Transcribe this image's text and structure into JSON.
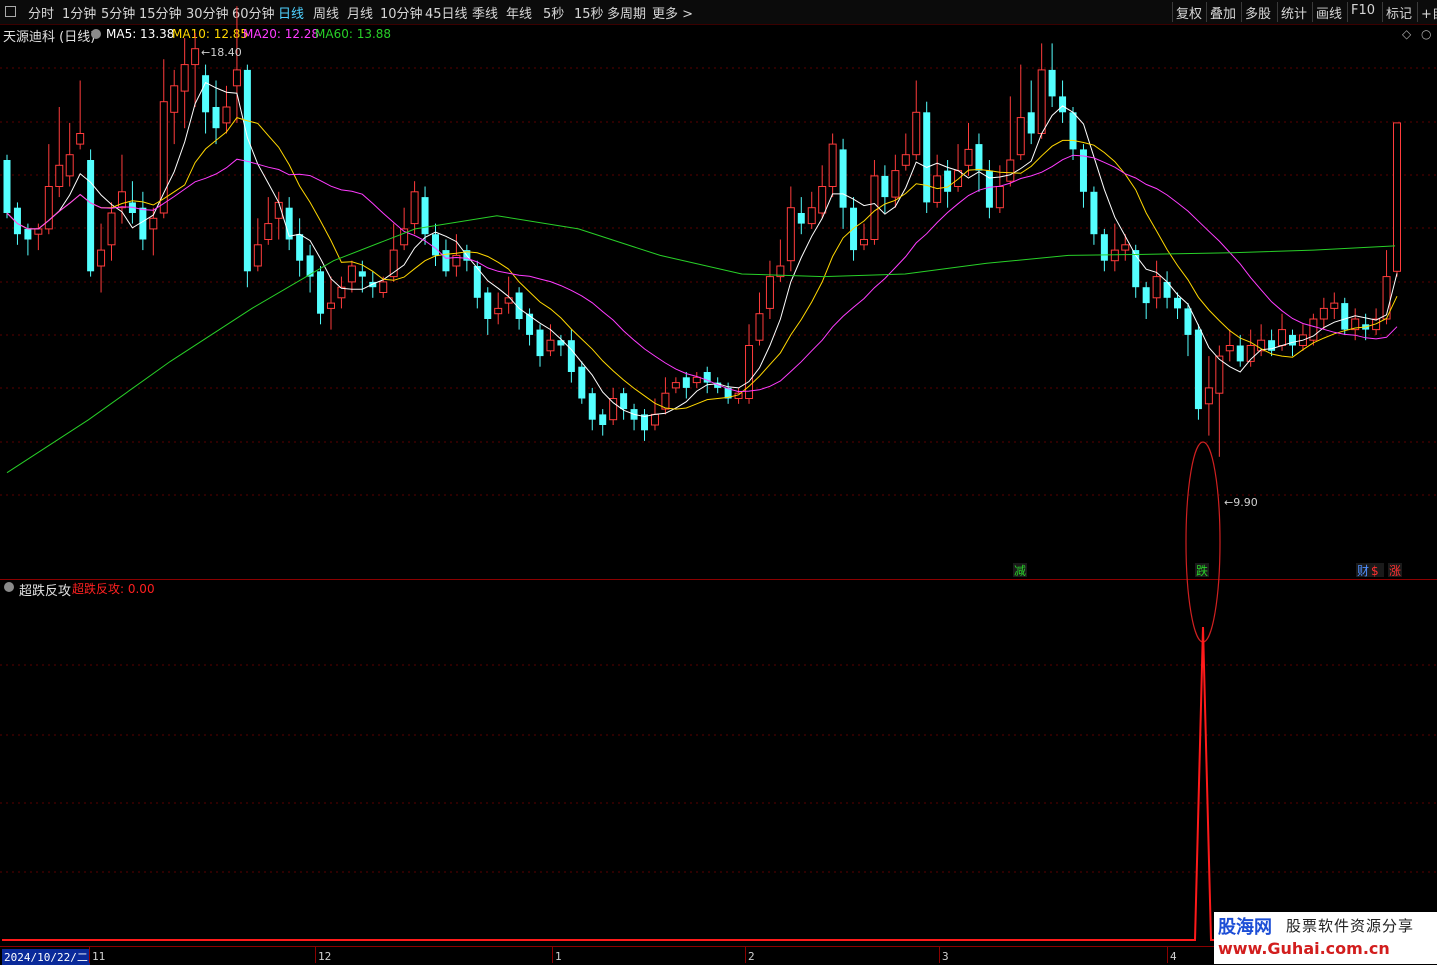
{
  "toolbar": {
    "left_items": [
      "分时",
      "1分钟",
      "5分钟",
      "15分钟",
      "30分钟",
      "60分钟",
      "日线",
      "周线",
      "月线",
      "10分钟",
      "45日线",
      "季线",
      "年线",
      "5秒",
      "15秒",
      "多周期",
      "更多 >"
    ],
    "active_item": "日线",
    "right_items": [
      "复权",
      "叠加",
      "多股",
      "统计",
      "画线",
      "F10",
      "标记",
      "+自"
    ]
  },
  "main_pane": {
    "stock_name": "天源迪科 (日线)",
    "ma": [
      {
        "label": "MA5: 13.38",
        "color": "#ffffff"
      },
      {
        "label": "MA10: 12.85",
        "color": "#ffd700"
      },
      {
        "label": "MA20: 12.28",
        "color": "#ff3cff"
      },
      {
        "label": "MA60: 13.88",
        "color": "#28d028"
      }
    ],
    "high_label": "18.40",
    "low_label": "9.90",
    "event_tags": [
      {
        "text": "减",
        "color": "#28d028"
      },
      {
        "text": "跌",
        "color": "#28d028"
      },
      {
        "text": "财",
        "color": "#4f8fff"
      },
      {
        "text": "$",
        "color": "#ff3030"
      },
      {
        "text": "涨",
        "color": "#ff3030"
      }
    ]
  },
  "sub_pane": {
    "indicator_name": "超跌反攻",
    "indicator_value": "超跌反攻: 0.00",
    "value_color": "#ff2020"
  },
  "x_axis": {
    "start_date": "2024/10/22/二",
    "labels": [
      "11",
      "12",
      "1",
      "2",
      "3",
      "4"
    ]
  },
  "watermark": {
    "title": "股海网",
    "subtitle": "股票软件资源分享",
    "url": "www.Guhai.com.cn"
  },
  "colors": {
    "up": "#ff3c3c",
    "down": "#54ffff",
    "ma5": "#ffffff",
    "ma10": "#ffd700",
    "ma20": "#ff3cff",
    "ma60": "#28d028",
    "grid": "#5a0000"
  },
  "chart_data": {
    "type": "candlestick",
    "ma_latest": {
      "MA5": 13.38,
      "MA10": 12.85,
      "MA20": 12.28,
      "MA60": 13.88
    },
    "period_high": 18.4,
    "period_low": 9.9,
    "indicator": {
      "name": "超跌反攻",
      "value": 0.0
    }
  }
}
